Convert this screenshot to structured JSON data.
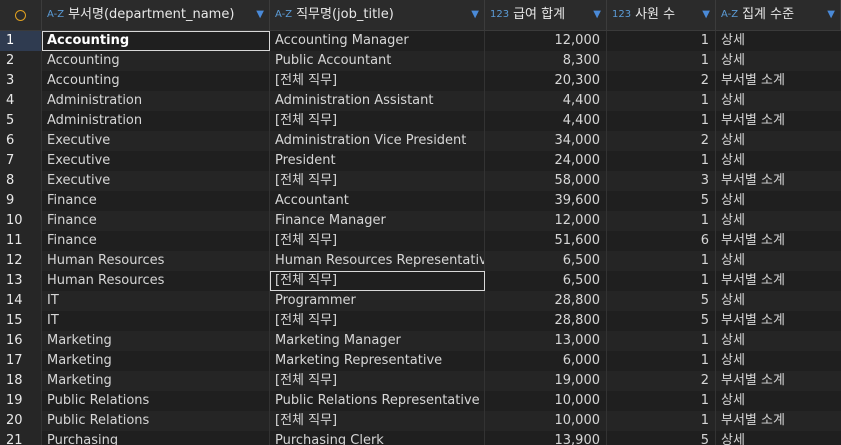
{
  "header": {
    "col1": {
      "type": "A-Z",
      "label": "부서명(department_name)"
    },
    "col2": {
      "type": "A-Z",
      "label": "직무명(job_title)"
    },
    "col3": {
      "type": "123",
      "label": "급여 합계"
    },
    "col4": {
      "type": "123",
      "label": "사원 수"
    },
    "col5": {
      "type": "A-Z",
      "label": "집계 수준"
    },
    "sort_icon": "chevron-down",
    "selector_icon": "circle-icon"
  },
  "rows": [
    {
      "n": "1",
      "dept": "Accounting",
      "job": "Accounting Manager",
      "sal": "12,000",
      "cnt": "1",
      "lvl": "상세"
    },
    {
      "n": "2",
      "dept": "Accounting",
      "job": "Public Accountant",
      "sal": "8,300",
      "cnt": "1",
      "lvl": "상세"
    },
    {
      "n": "3",
      "dept": "Accounting",
      "job": "[전체 직무]",
      "sal": "20,300",
      "cnt": "2",
      "lvl": "부서별 소계"
    },
    {
      "n": "4",
      "dept": "Administration",
      "job": "Administration Assistant",
      "sal": "4,400",
      "cnt": "1",
      "lvl": "상세"
    },
    {
      "n": "5",
      "dept": "Administration",
      "job": "[전체 직무]",
      "sal": "4,400",
      "cnt": "1",
      "lvl": "부서별 소계"
    },
    {
      "n": "6",
      "dept": "Executive",
      "job": "Administration Vice President",
      "sal": "34,000",
      "cnt": "2",
      "lvl": "상세"
    },
    {
      "n": "7",
      "dept": "Executive",
      "job": "President",
      "sal": "24,000",
      "cnt": "1",
      "lvl": "상세"
    },
    {
      "n": "8",
      "dept": "Executive",
      "job": "[전체 직무]",
      "sal": "58,000",
      "cnt": "3",
      "lvl": "부서별 소계"
    },
    {
      "n": "9",
      "dept": "Finance",
      "job": "Accountant",
      "sal": "39,600",
      "cnt": "5",
      "lvl": "상세"
    },
    {
      "n": "10",
      "dept": "Finance",
      "job": "Finance Manager",
      "sal": "12,000",
      "cnt": "1",
      "lvl": "상세"
    },
    {
      "n": "11",
      "dept": "Finance",
      "job": "[전체 직무]",
      "sal": "51,600",
      "cnt": "6",
      "lvl": "부서별 소계"
    },
    {
      "n": "12",
      "dept": "Human Resources",
      "job": "Human Resources Representative",
      "sal": "6,500",
      "cnt": "1",
      "lvl": "상세"
    },
    {
      "n": "13",
      "dept": "Human Resources",
      "job": "[전체 직무]",
      "sal": "6,500",
      "cnt": "1",
      "lvl": "부서별 소계"
    },
    {
      "n": "14",
      "dept": "IT",
      "job": "Programmer",
      "sal": "28,800",
      "cnt": "5",
      "lvl": "상세"
    },
    {
      "n": "15",
      "dept": "IT",
      "job": "[전체 직무]",
      "sal": "28,800",
      "cnt": "5",
      "lvl": "부서별 소계"
    },
    {
      "n": "16",
      "dept": "Marketing",
      "job": "Marketing Manager",
      "sal": "13,000",
      "cnt": "1",
      "lvl": "상세"
    },
    {
      "n": "17",
      "dept": "Marketing",
      "job": "Marketing Representative",
      "sal": "6,000",
      "cnt": "1",
      "lvl": "상세"
    },
    {
      "n": "18",
      "dept": "Marketing",
      "job": "[전체 직무]",
      "sal": "19,000",
      "cnt": "2",
      "lvl": "부서별 소계"
    },
    {
      "n": "19",
      "dept": "Public Relations",
      "job": "Public Relations Representative",
      "sal": "10,000",
      "cnt": "1",
      "lvl": "상세"
    },
    {
      "n": "20",
      "dept": "Public Relations",
      "job": "[전체 직무]",
      "sal": "10,000",
      "cnt": "1",
      "lvl": "부서별 소계"
    },
    {
      "n": "21",
      "dept": "Purchasing",
      "job": "Purchasing Clerk",
      "sal": "13,900",
      "cnt": "5",
      "lvl": "상세"
    }
  ],
  "selected_row": "1",
  "boxed_cell": {
    "row": "13",
    "col": "job"
  }
}
